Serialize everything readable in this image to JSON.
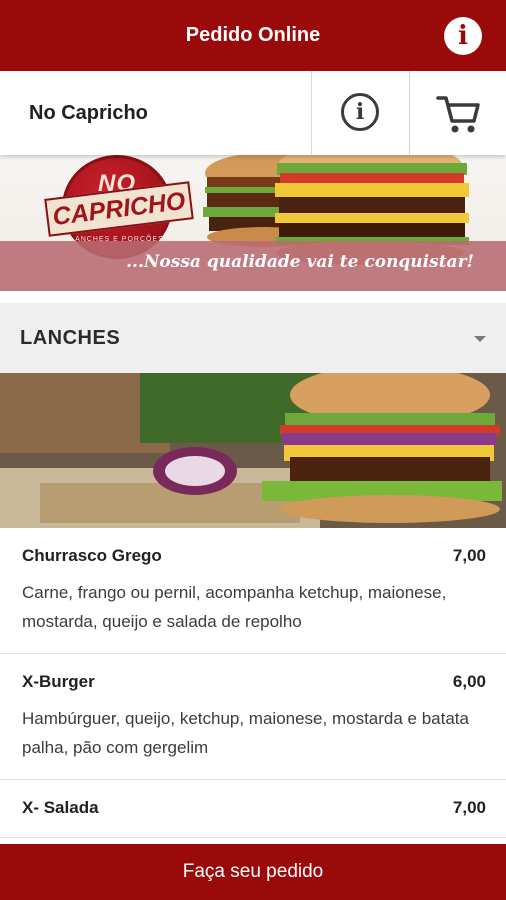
{
  "topbar": {
    "title": "Pedido Online",
    "info_icon": "info-icon"
  },
  "store": {
    "name": "No Capricho",
    "info_icon": "info-outline-icon",
    "cart_icon": "cart-icon"
  },
  "banner": {
    "logo_top": "NO",
    "logo_main": "CAPRICHO",
    "logo_sub": "LANCHES E PORÇÕES",
    "slogan": "...Nossa qualidade vai te conquistar!"
  },
  "category": {
    "label": "LANCHES",
    "chevron_icon": "chevron-down-icon"
  },
  "menu": {
    "items": [
      {
        "name": "Churrasco Grego",
        "price": "7,00",
        "description": "Carne, frango ou pernil, acompanha ketchup, maionese, mostarda, queijo e salada de repolho"
      },
      {
        "name": "X-Burger",
        "price": "6,00",
        "description": "Hambúrguer, queijo, ketchup, maionese, mostarda e batata palha, pão com gergelim"
      },
      {
        "name": "X- Salada",
        "price": "7,00",
        "description": ""
      }
    ]
  },
  "order_button": {
    "label": "Faça seu pedido"
  },
  "colors": {
    "brand": "#9b0a0a",
    "category_bg": "#efefef"
  }
}
